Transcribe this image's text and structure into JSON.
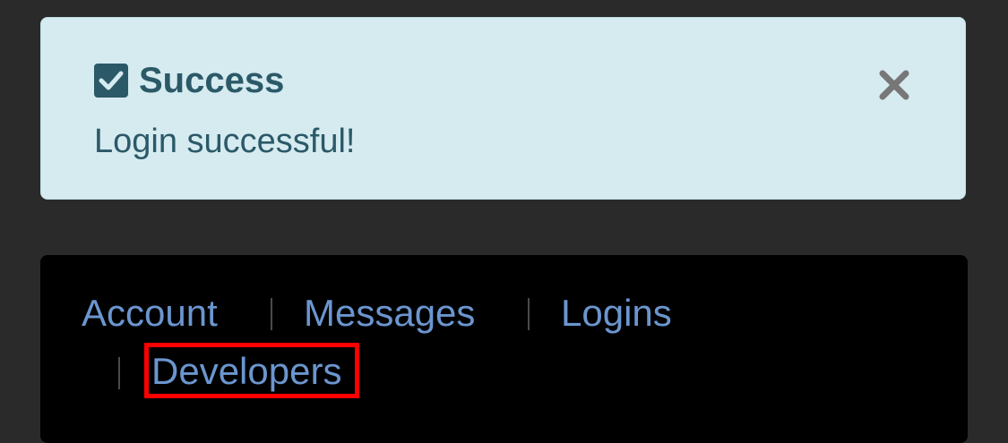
{
  "alert": {
    "title": "Success",
    "message": "Login successful!",
    "icon": "check-square-icon",
    "close_icon": "close-icon",
    "colors": {
      "background": "#d5ebf0",
      "text": "#2b5968"
    }
  },
  "nav": {
    "items": [
      {
        "label": "Account"
      },
      {
        "label": "Messages"
      },
      {
        "label": "Logins"
      },
      {
        "label": "Developers",
        "highlighted": true
      }
    ],
    "colors": {
      "link": "#6b96cf",
      "background": "#000000",
      "highlight": "#ff0000"
    }
  }
}
